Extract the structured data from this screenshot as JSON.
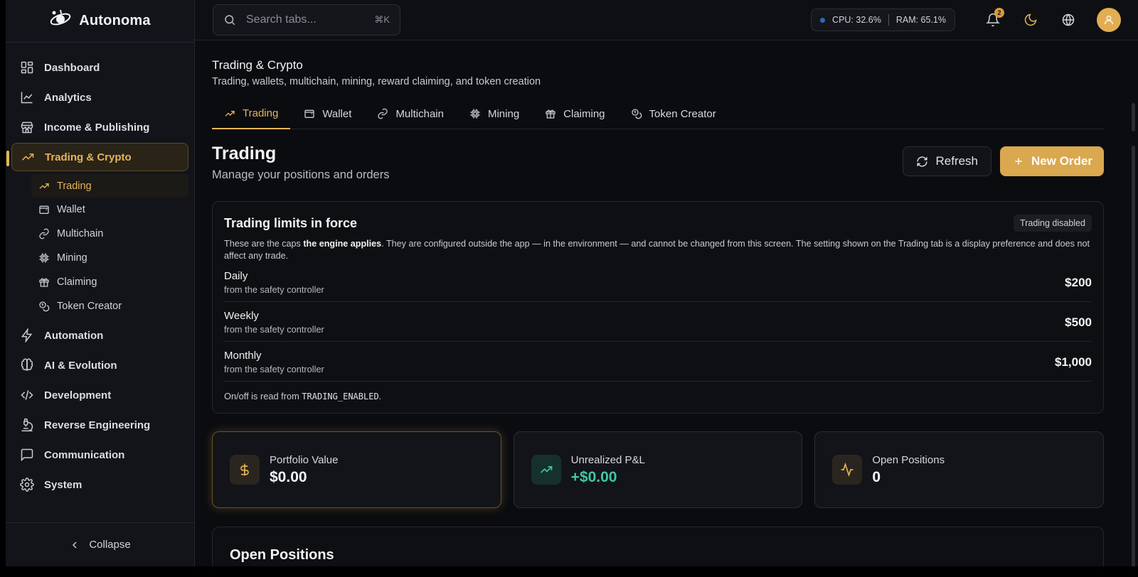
{
  "brand": {
    "name": "Autonoma"
  },
  "sidebar": {
    "items": [
      {
        "label": "Dashboard"
      },
      {
        "label": "Analytics"
      },
      {
        "label": "Income & Publishing"
      },
      {
        "label": "Trading & Crypto"
      },
      {
        "label": "Automation"
      },
      {
        "label": "AI & Evolution"
      },
      {
        "label": "Development"
      },
      {
        "label": "Reverse Engineering"
      },
      {
        "label": "Communication"
      },
      {
        "label": "System"
      }
    ],
    "sub_items": [
      {
        "label": "Trading"
      },
      {
        "label": "Wallet"
      },
      {
        "label": "Multichain"
      },
      {
        "label": "Mining"
      },
      {
        "label": "Claiming"
      },
      {
        "label": "Token Creator"
      }
    ],
    "collapse_label": "Collapse"
  },
  "topbar": {
    "search_placeholder": "Search tabs...",
    "search_shortcut": "⌘K",
    "cpu": "CPU: 32.6%",
    "ram": "RAM: 65.1%",
    "notification_count": "2"
  },
  "section": {
    "title": "Trading & Crypto",
    "subtitle": "Trading, wallets, multichain, mining, reward claiming, and token creation"
  },
  "tabs": [
    {
      "label": "Trading"
    },
    {
      "label": "Wallet"
    },
    {
      "label": "Multichain"
    },
    {
      "label": "Mining"
    },
    {
      "label": "Claiming"
    },
    {
      "label": "Token Creator"
    }
  ],
  "page": {
    "title": "Trading",
    "subtitle": "Manage your positions and orders",
    "refresh_label": "Refresh",
    "new_order_label": "New Order"
  },
  "limits": {
    "title": "Trading limits in force",
    "status": "Trading disabled",
    "desc_pre": "These are the caps ",
    "desc_bold": "the engine applies",
    "desc_post": ". They are configured outside the app — in the environment — and cannot be changed from this screen. The setting shown on the Trading tab is a display preference and does not affect any trade.",
    "rows": [
      {
        "name": "Daily",
        "source": "from the safety controller",
        "value": "$200"
      },
      {
        "name": "Weekly",
        "source": "from the safety controller",
        "value": "$500"
      },
      {
        "name": "Monthly",
        "source": "from the safety controller",
        "value": "$1,000"
      }
    ],
    "foot_pre": "On/off is read from ",
    "foot_code": "TRADING_ENABLED",
    "foot_post": "."
  },
  "stats": [
    {
      "label": "Portfolio Value",
      "value": "$0.00"
    },
    {
      "label": "Unrealized P&L",
      "value": "+$0.00"
    },
    {
      "label": "Open Positions",
      "value": "0"
    }
  ],
  "positions": {
    "title": "Open Positions"
  },
  "colors": {
    "accent": "#e6b457",
    "positive": "#3fc8a3",
    "background": "#0b0c10"
  }
}
